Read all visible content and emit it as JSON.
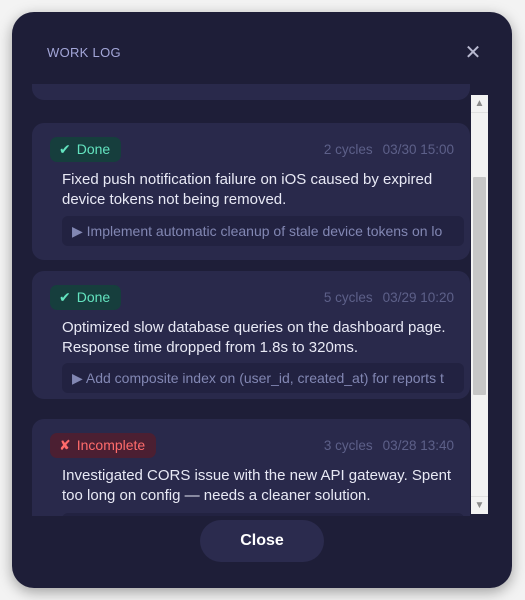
{
  "dialog": {
    "title": "WORK LOG",
    "close_icon": "✕",
    "close_button": "Close"
  },
  "entries": [
    {
      "status": "Done",
      "status_icon": "✔",
      "cycles": "2 cycles",
      "timestamp": "03/30 15:00",
      "description": "Fixed push notification failure on iOS caused by expired device tokens not being removed.",
      "note": "▶ Implement automatic cleanup of stale device tokens on lo"
    },
    {
      "status": "Done",
      "status_icon": "✔",
      "cycles": "5 cycles",
      "timestamp": "03/29 10:20",
      "description": "Optimized slow database queries on the dashboard page. Response time dropped from 1.8s to 320ms.",
      "note": "▶ Add composite index on (user_id, created_at) for reports t"
    },
    {
      "status": "Incomplete",
      "status_icon": "✘",
      "cycles": "3 cycles",
      "timestamp": "03/28 13:40",
      "description": "Investigated CORS issue with the new API gateway. Spent too long on config — needs a cleaner solution.",
      "note": ""
    }
  ],
  "scrollbar": {
    "up_icon": "▲",
    "down_icon": "▼",
    "position_fraction": 0.25
  },
  "colors": {
    "modal_bg": "#1e1e38",
    "card_bg": "#29294b",
    "done_badge_bg": "#163e3d",
    "done_badge_text": "#63e3bf",
    "incomplete_badge_bg": "#4b1f32",
    "incomplete_badge_text": "#ff6b6b"
  }
}
